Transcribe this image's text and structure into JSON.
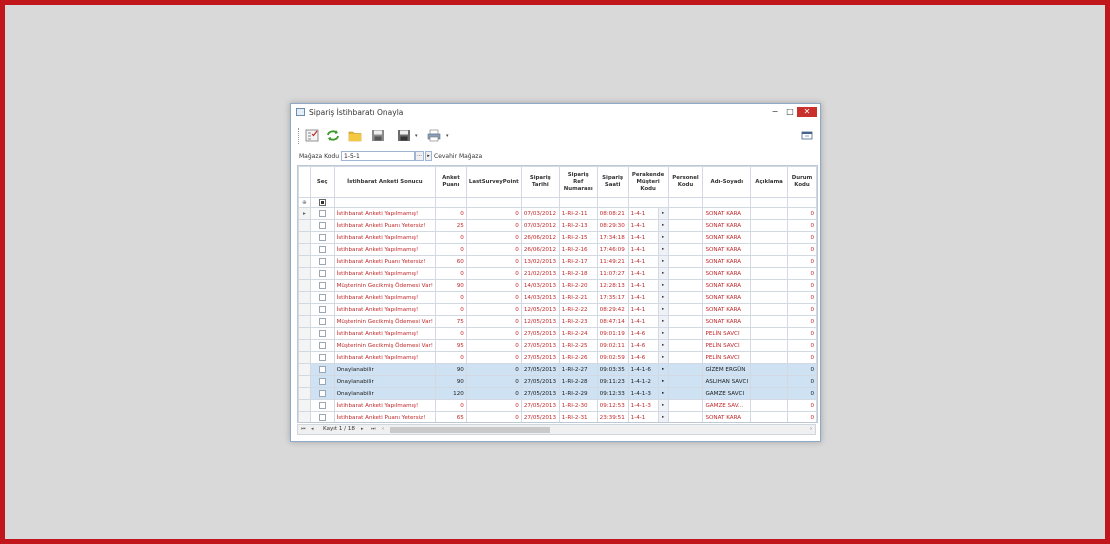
{
  "window": {
    "title": "Sipariş İstihbaratı Onayla",
    "minimize_glyph": "−",
    "maximize_glyph": "□",
    "close_glyph": "✕"
  },
  "toolbar": {
    "icons": [
      "checklist-icon",
      "refresh-icon",
      "folder-icon",
      "save-icon",
      "save-as-icon",
      "print-icon",
      "layout-icon"
    ]
  },
  "filter": {
    "label": "Mağaza Kodu",
    "store_code": "1-5-1",
    "browse_glyph": "···",
    "go_glyph": "▸",
    "store_name": "Cevahir Mağaza"
  },
  "grid": {
    "columns": [
      "Seç",
      "İstihbarat Anketi Sonucu",
      "Anket Puanı",
      "LastSurveyPoint",
      "Sipariş Tarihi",
      "Sipariş Ref Numarası",
      "Sipariş Saati",
      "Perakende Müşteri Kodu",
      "Personel Kodu",
      "Adı-Soyadı",
      "Açıklama",
      "Durum Kodu"
    ],
    "filter_row_glyph": "⊕",
    "current_row_glyph": "▸",
    "cell_button_glyph": "▸",
    "rows": [
      {
        "status": "red",
        "sonuc": "İstihbarat Anketi Yapılmamış!",
        "puan": "0",
        "last": "0",
        "tarih": "07/03/2012",
        "ref": "1-RI-2-11",
        "saat": "08:08:21",
        "musteri": "1-4-1",
        "personel": "",
        "ad": "SONAT KARA",
        "aciklama": "",
        "durum": "0"
      },
      {
        "status": "red",
        "sonuc": "İstihbarat Anketi Puanı Yetersiz!",
        "puan": "25",
        "last": "0",
        "tarih": "07/03/2012",
        "ref": "1-RI-2-13",
        "saat": "08:29:30",
        "musteri": "1-4-1",
        "personel": "",
        "ad": "SONAT KARA",
        "aciklama": "",
        "durum": "0"
      },
      {
        "status": "red",
        "sonuc": "İstihbarat Anketi Yapılmamış!",
        "puan": "0",
        "last": "0",
        "tarih": "26/06/2012",
        "ref": "1-RI-2-15",
        "saat": "17:34:18",
        "musteri": "1-4-1",
        "personel": "",
        "ad": "SONAT KARA",
        "aciklama": "",
        "durum": "0"
      },
      {
        "status": "red",
        "sonuc": "İstihbarat Anketi Yapılmamış!",
        "puan": "0",
        "last": "0",
        "tarih": "26/06/2012",
        "ref": "1-RI-2-16",
        "saat": "17:46:09",
        "musteri": "1-4-1",
        "personel": "",
        "ad": "SONAT KARA",
        "aciklama": "",
        "durum": "0"
      },
      {
        "status": "red",
        "sonuc": "İstihbarat Anketi Puanı Yetersiz!",
        "puan": "60",
        "last": "0",
        "tarih": "13/02/2013",
        "ref": "1-RI-2-17",
        "saat": "11:49:21",
        "musteri": "1-4-1",
        "personel": "",
        "ad": "SONAT KARA",
        "aciklama": "",
        "durum": "0"
      },
      {
        "status": "red",
        "sonuc": "İstihbarat Anketi Yapılmamış!",
        "puan": "0",
        "last": "0",
        "tarih": "21/02/2013",
        "ref": "1-RI-2-18",
        "saat": "11:07:27",
        "musteri": "1-4-1",
        "personel": "",
        "ad": "SONAT KARA",
        "aciklama": "",
        "durum": "0"
      },
      {
        "status": "red",
        "sonuc": "Müşterinin Gecikmiş Ödemesi Var!",
        "puan": "90",
        "last": "0",
        "tarih": "14/03/2013",
        "ref": "1-RI-2-20",
        "saat": "12:28:13",
        "musteri": "1-4-1",
        "personel": "",
        "ad": "SONAT KARA",
        "aciklama": "",
        "durum": "0"
      },
      {
        "status": "red",
        "sonuc": "İstihbarat Anketi Yapılmamış!",
        "puan": "0",
        "last": "0",
        "tarih": "14/03/2013",
        "ref": "1-RI-2-21",
        "saat": "17:35:17",
        "musteri": "1-4-1",
        "personel": "",
        "ad": "SONAT KARA",
        "aciklama": "",
        "durum": "0"
      },
      {
        "status": "red",
        "sonuc": "İstihbarat Anketi Yapılmamış!",
        "puan": "0",
        "last": "0",
        "tarih": "12/05/2013",
        "ref": "1-RI-2-22",
        "saat": "08:29:42",
        "musteri": "1-4-1",
        "personel": "",
        "ad": "SONAT KARA",
        "aciklama": "",
        "durum": "0"
      },
      {
        "status": "red",
        "sonuc": "Müşterinin Gecikmiş Ödemesi Var!",
        "puan": "75",
        "last": "0",
        "tarih": "12/05/2013",
        "ref": "1-RI-2-23",
        "saat": "08:47:14",
        "musteri": "1-4-1",
        "personel": "",
        "ad": "SONAT KARA",
        "aciklama": "",
        "durum": "0"
      },
      {
        "status": "red",
        "sonuc": "İstihbarat Anketi Yapılmamış!",
        "puan": "0",
        "last": "0",
        "tarih": "27/05/2013",
        "ref": "1-RI-2-24",
        "saat": "09:01:19",
        "musteri": "1-4-6",
        "personel": "",
        "ad": "PELİN SAVCI",
        "aciklama": "",
        "durum": "0"
      },
      {
        "status": "red",
        "sonuc": "Müşterinin Gecikmiş Ödemesi Var!",
        "puan": "95",
        "last": "0",
        "tarih": "27/05/2013",
        "ref": "1-RI-2-25",
        "saat": "09:02:11",
        "musteri": "1-4-6",
        "personel": "",
        "ad": "PELİN SAVCI",
        "aciklama": "",
        "durum": "0"
      },
      {
        "status": "red",
        "sonuc": "İstihbarat Anketi Yapılmamış!",
        "puan": "0",
        "last": "0",
        "tarih": "27/05/2013",
        "ref": "1-RI-2-26",
        "saat": "09:02:59",
        "musteri": "1-4-6",
        "personel": "",
        "ad": "PELİN SAVCI",
        "aciklama": "",
        "durum": "0"
      },
      {
        "status": "blue",
        "sonuc": "Onaylanabilir",
        "puan": "90",
        "last": "0",
        "tarih": "27/05/2013",
        "ref": "1-RI-2-27",
        "saat": "09:03:35",
        "musteri": "1-4-1-6",
        "personel": "",
        "ad": "GİZEM ERGÜN",
        "aciklama": "",
        "durum": "0"
      },
      {
        "status": "blue",
        "sonuc": "Onaylanabilir",
        "puan": "90",
        "last": "0",
        "tarih": "27/05/2013",
        "ref": "1-RI-2-28",
        "saat": "09:11:23",
        "musteri": "1-4-1-2",
        "personel": "",
        "ad": "ASLIHAN SAVCI",
        "aciklama": "",
        "durum": "0"
      },
      {
        "status": "blue",
        "sonuc": "Onaylanabilir",
        "puan": "120",
        "last": "0",
        "tarih": "27/05/2013",
        "ref": "1-RI-2-29",
        "saat": "09:12:33",
        "musteri": "1-4-1-3",
        "personel": "",
        "ad": "GAMZE SAVCI",
        "aciklama": "",
        "durum": "0"
      },
      {
        "status": "red",
        "sonuc": "İstihbarat Anketi Yapılmamış!",
        "puan": "0",
        "last": "0",
        "tarih": "27/05/2013",
        "ref": "1-RI-2-30",
        "saat": "09:12:53",
        "musteri": "1-4-1-3",
        "personel": "",
        "ad": "GAMZE SAV...",
        "aciklama": "",
        "durum": "0"
      },
      {
        "status": "red",
        "sonuc": "İstihbarat Anketi Puanı Yetersiz!",
        "puan": "65",
        "last": "0",
        "tarih": "27/05/2013",
        "ref": "1-RI-2-31",
        "saat": "23:39:51",
        "musteri": "1-4-1",
        "personel": "",
        "ad": "SONAT KARA",
        "aciklama": "",
        "durum": "0"
      }
    ]
  },
  "navigator": {
    "first_glyph": "⏮",
    "prev_glyph": "◂",
    "record_text": "Kayıt 1 / 18",
    "next_glyph": "▸",
    "last_glyph": "⏭",
    "left_glyph": "‹",
    "right_glyph": "›"
  },
  "colors": {
    "frame_border": "#c1161c",
    "warning_text": "#c0282a",
    "approvable_row": "#cfe2f3",
    "close_button": "#c9302c"
  }
}
